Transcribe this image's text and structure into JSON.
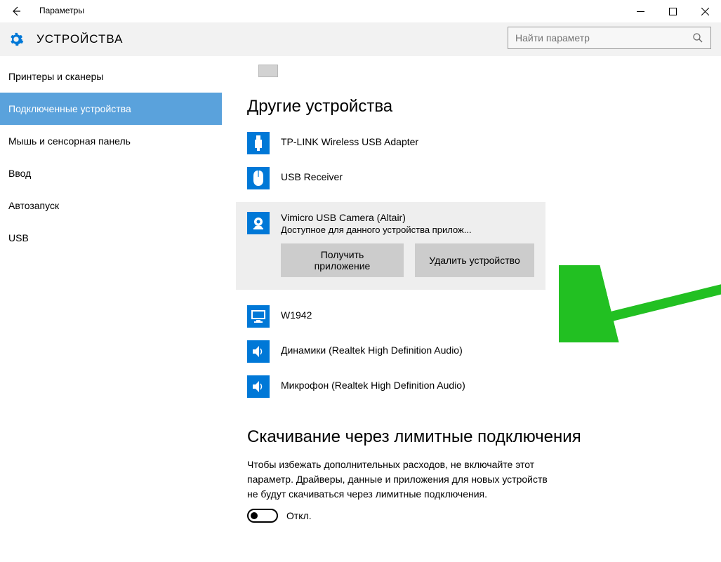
{
  "window": {
    "title": "Параметры"
  },
  "header": {
    "title": "УСТРОЙСТВА",
    "search_placeholder": "Найти параметр"
  },
  "sidebar": {
    "items": [
      {
        "label": "Принтеры и сканеры"
      },
      {
        "label": "Подключенные устройства"
      },
      {
        "label": "Мышь и сенсорная панель"
      },
      {
        "label": "Ввод"
      },
      {
        "label": "Автозапуск"
      },
      {
        "label": "USB"
      }
    ],
    "selected_index": 1
  },
  "content": {
    "section1_title": "Другие устройства",
    "devices": [
      {
        "name": "TP-LINK Wireless USB Adapter",
        "icon": "usb-adapter"
      },
      {
        "name": "USB Receiver",
        "icon": "mouse"
      },
      {
        "name": "Vimicro USB Camera (Altair)",
        "icon": "camera",
        "sub": "Доступное для данного устройства прилож...",
        "selected": true
      },
      {
        "name": "W1942",
        "icon": "monitor"
      },
      {
        "name": "Динамики (Realtek High Definition Audio)",
        "icon": "speaker"
      },
      {
        "name": "Микрофон (Realtek High Definition Audio)",
        "icon": "mic"
      }
    ],
    "actions": {
      "get_app": "Получить приложение",
      "remove": "Удалить устройство"
    },
    "section2_title": "Скачивание через лимитные подключения",
    "section2_note": "Чтобы избежать дополнительных расходов, не включайте этот параметр. Драйверы, данные и приложения для новых устройств не будут скачиваться через лимитные подключения.",
    "toggle_label": "Откл."
  }
}
